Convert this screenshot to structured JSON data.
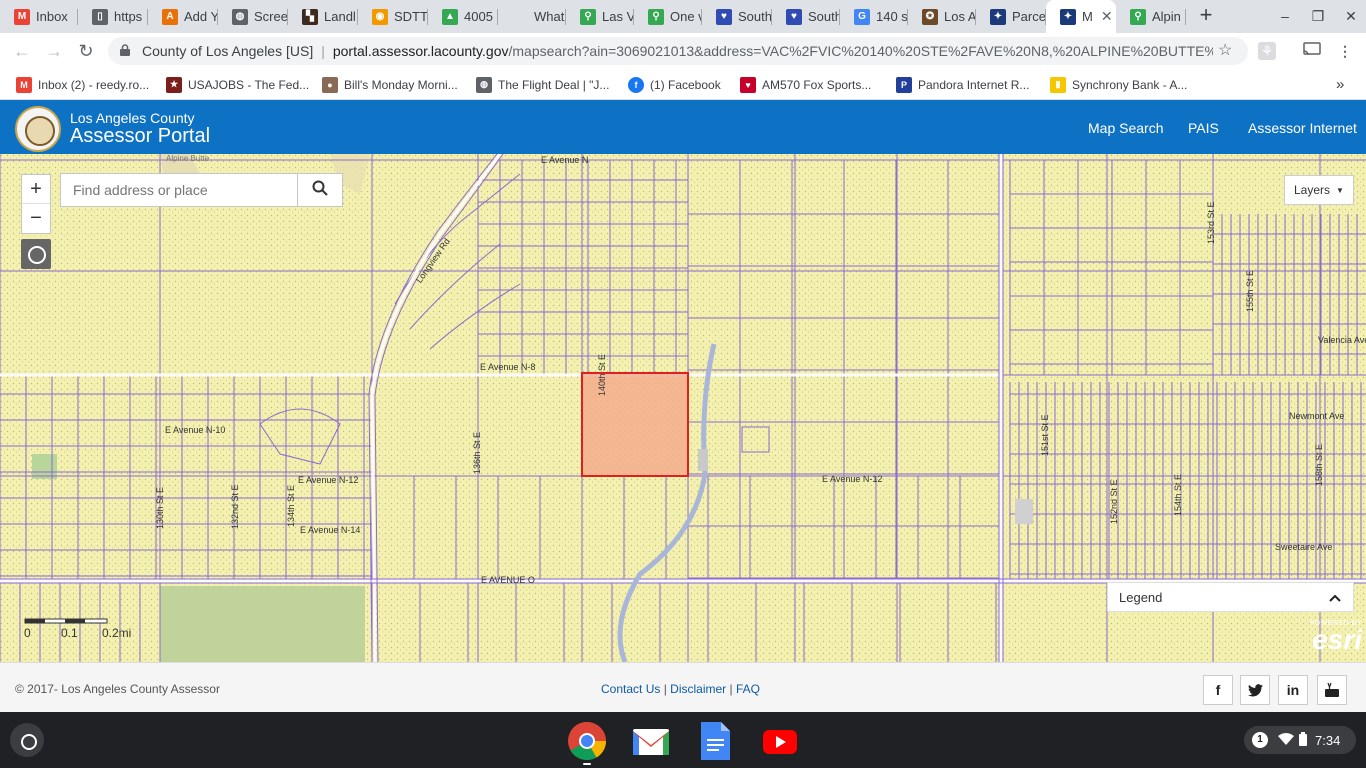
{
  "browser": {
    "tabs": [
      {
        "title": "Inbox",
        "icon": "gmail-icon"
      },
      {
        "title": "https",
        "icon": "document-icon"
      },
      {
        "title": "Add Y",
        "icon": "add-icon"
      },
      {
        "title": "Scree",
        "icon": "globe-icon"
      },
      {
        "title": "Landl",
        "icon": "bookmark-icon"
      },
      {
        "title": "SDTT",
        "icon": "coin-icon"
      },
      {
        "title": "4005",
        "icon": "drive-icon"
      },
      {
        "title": "What",
        "icon": ""
      },
      {
        "title": "Las V",
        "icon": "maps-icon"
      },
      {
        "title": "One v",
        "icon": "maps-icon"
      },
      {
        "title": "South",
        "icon": "southwest-icon"
      },
      {
        "title": "South",
        "icon": "southwest-icon"
      },
      {
        "title": "140 s",
        "icon": "google-icon"
      },
      {
        "title": "Los A",
        "icon": "seal-icon"
      },
      {
        "title": "Parce",
        "icon": "parcel-icon"
      },
      {
        "title": "M",
        "icon": "parcel-icon",
        "active": true
      },
      {
        "title": "Alpin",
        "icon": "maps-icon"
      }
    ],
    "site_name": "County of Los Angeles [US]",
    "url_domain": "portal.assessor.lacounty.gov",
    "url_path": "/mapsearch?ain=3069021013&address=VAC%2FVIC%20140%20STE%2FAVE%20N8,%20ALPINE%20BUTTE%2...",
    "bookmarks": [
      {
        "label": "Inbox (2) - reedy.ro...",
        "icon": "gmail-icon"
      },
      {
        "label": "USAJOBS - The Fed...",
        "icon": "usajobs-icon"
      },
      {
        "label": "Bill's Monday Morni...",
        "icon": "avatar-icon"
      },
      {
        "label": "The Flight Deal | \"J...",
        "icon": "globe-icon"
      },
      {
        "label": "(1) Facebook",
        "icon": "facebook-icon"
      },
      {
        "label": "AM570 Fox Sports...",
        "icon": "iheart-icon"
      },
      {
        "label": "Pandora Internet R...",
        "icon": "pandora-icon"
      },
      {
        "label": "Synchrony Bank - A...",
        "icon": "synchrony-icon"
      }
    ],
    "overflow_label": "»"
  },
  "portal": {
    "county": "Los Angeles County",
    "title": "Assessor Portal",
    "nav": [
      "Map Search",
      "PAIS",
      "Assessor Internet"
    ],
    "brand_color": "#0e72c4"
  },
  "map": {
    "search_placeholder": "Find address or place",
    "layers_label": "Layers",
    "legend_label": "Legend",
    "zoom_in": "+",
    "zoom_out": "−",
    "scale_ticks": [
      "0",
      "0.1",
      "0.2mi"
    ],
    "esri_powered": "POWERED BY",
    "esri_logo": "esri",
    "selected_parcel_color": "#e02020",
    "street_labels": [
      "E Avenue N",
      "E Avenue N-8",
      "E Avenue N-10",
      "E Avenue N-12",
      "E Avenue N-12",
      "E Avenue N-14",
      "E AVENUE O",
      "140th St E",
      "136th St E",
      "134th St E",
      "132nd St E",
      "130th St E",
      "Longview Rd",
      "Alpine Butte",
      "151st St E",
      "152nd St E",
      "154th St E",
      "155th St E",
      "153rd St E",
      "158th St E",
      "Valencia Ave",
      "Newmont Ave",
      "Sweetaire Ave"
    ]
  },
  "footer": {
    "copyright": "© 2017- Los Angeles County Assessor",
    "links": [
      "Contact Us",
      "Disclaimer",
      "FAQ"
    ],
    "social": [
      "f",
      "t",
      "in",
      "yt"
    ]
  },
  "shelf": {
    "apps": [
      "chrome",
      "gmail",
      "docs",
      "youtube"
    ],
    "notification_count": "1",
    "time": "7:34"
  }
}
